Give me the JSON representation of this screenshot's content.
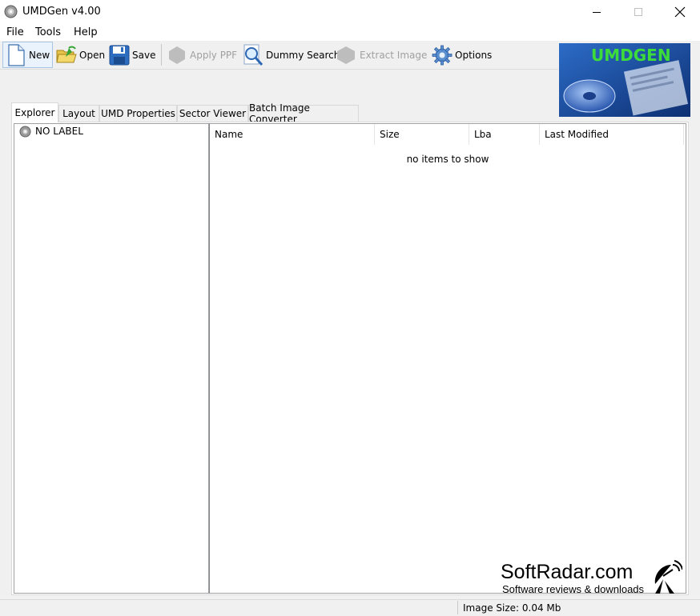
{
  "window": {
    "title": "UMDGen v4.00",
    "icons": {
      "app": "disc-icon",
      "minimize": "minimize-icon",
      "maximize": "maximize-icon",
      "close": "close-icon"
    }
  },
  "menu": {
    "items": [
      "File",
      "Tools",
      "Help"
    ]
  },
  "toolbar": {
    "new": "New",
    "open": "Open",
    "save": "Save",
    "apply_ppf": "Apply PPF",
    "dummy_search": "Dummy Search",
    "extract_image": "Extract Image",
    "options": "Options"
  },
  "logo": {
    "text": "UMDGEN"
  },
  "tabs": [
    "Explorer",
    "Layout",
    "UMD Properties",
    "Sector Viewer",
    "Batch Image Converter"
  ],
  "active_tab": "Explorer",
  "tree": {
    "root_label": "NO LABEL"
  },
  "list": {
    "columns": [
      "Name",
      "Size",
      "Lba",
      "Last Modified"
    ],
    "empty_message": "no items to show"
  },
  "status": {
    "image_size": "Image Size: 0.04 Mb"
  },
  "watermark": {
    "title": "SoftRadar.com",
    "subtitle": "Software reviews & downloads"
  },
  "colors": {
    "accent": "#3a8fd6",
    "logo_bg": "#1b4fa0",
    "logo_text": "#3ddc3a"
  }
}
